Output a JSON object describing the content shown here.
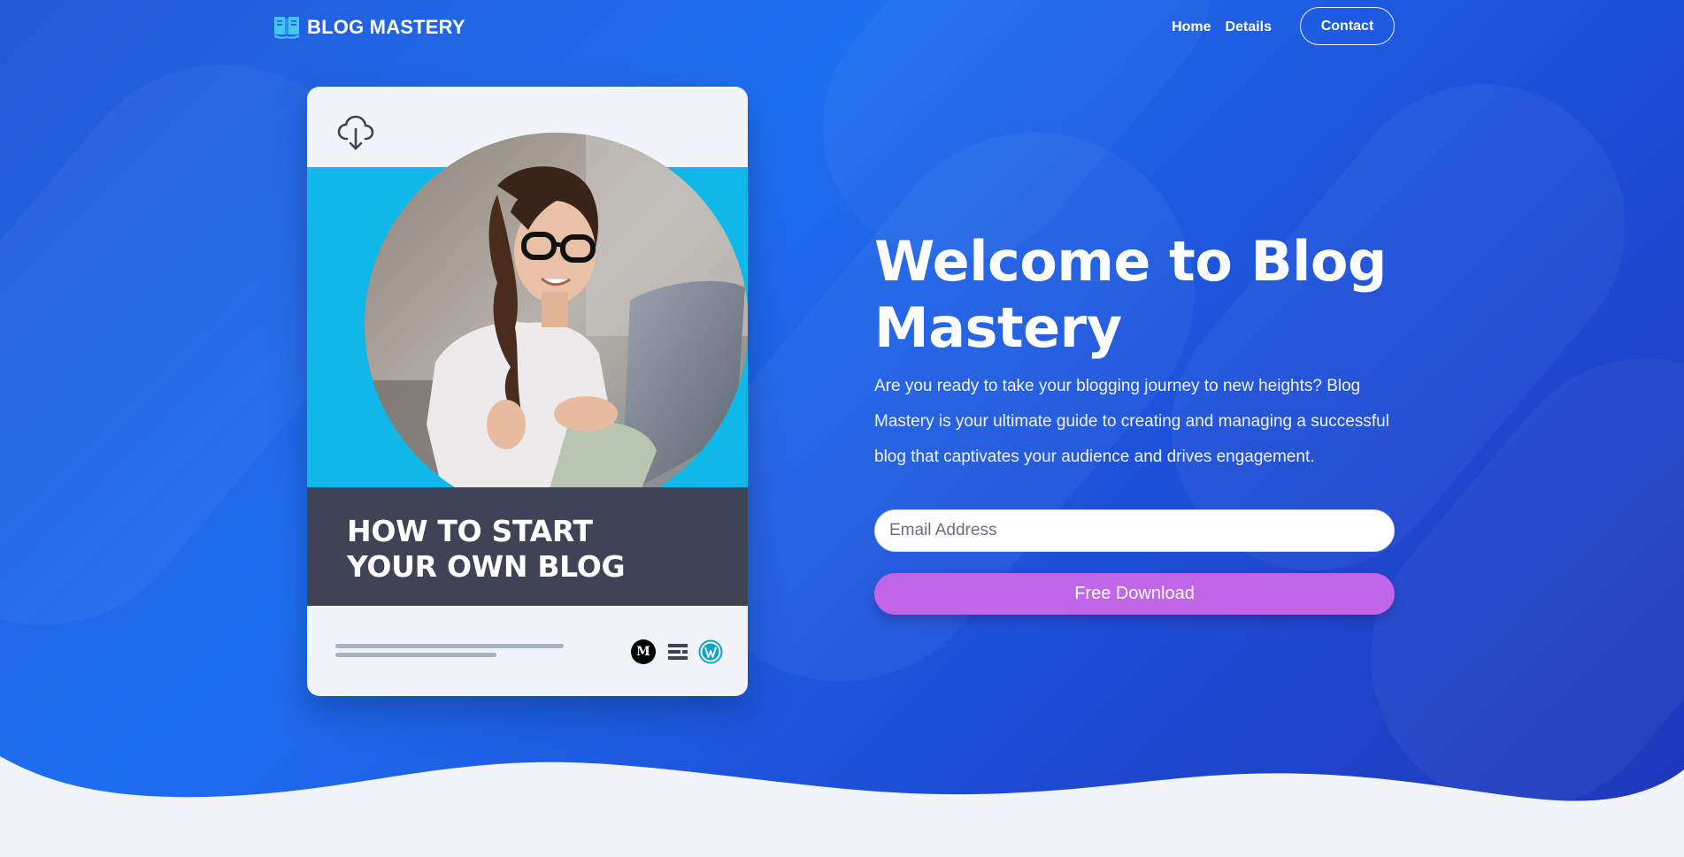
{
  "nav": {
    "brand": "BLOG MASTERY",
    "home": "Home",
    "details": "Details",
    "contact": "Contact"
  },
  "card": {
    "title": "HOW TO START YOUR OWN BLOG",
    "platforms": [
      "medium-icon",
      "substack-icon",
      "wordpress-icon"
    ],
    "medium_letter": "M"
  },
  "hero": {
    "headline": "Welcome to Blog Mastery",
    "subtext": "Are you ready to take your blogging journey to new heights? Blog Mastery is your ultimate guide to creating and managing a successful blog that captivates your audience and drives engagement.",
    "email_placeholder": "Email Address",
    "email_value": "",
    "cta": "Free Download"
  },
  "colors": {
    "accent": "#c066e6",
    "hero_blue": "#1e6ff0",
    "card_cyan": "#0fb8e8",
    "card_band": "#3e4456",
    "page_bg": "#f1f5f9"
  }
}
